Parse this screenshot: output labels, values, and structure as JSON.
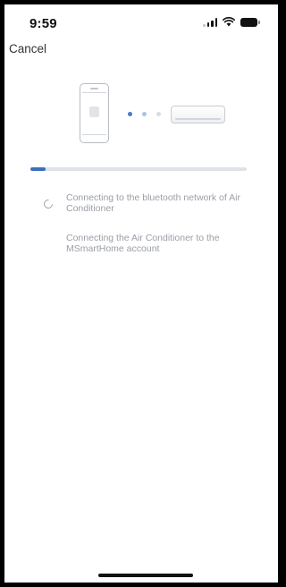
{
  "status_bar": {
    "time": "9:59",
    "icons": [
      "signal-icon",
      "wifi-icon",
      "battery-icon"
    ]
  },
  "header": {
    "cancel_label": "Cancel"
  },
  "illustration": {
    "icons": [
      "phone-icon",
      "progress-dots",
      "air-conditioner-icon"
    ],
    "dot_colors": [
      "#4a7bc8",
      "#aac2e3",
      "#d7dce3"
    ]
  },
  "progress": {
    "fraction": 0.07,
    "color": "#3c6fc1",
    "track_color": "#dfe2e7"
  },
  "steps": [
    {
      "text": "Connecting to the bluetooth network of Air Conditioner",
      "status": "in-progress",
      "icon": "spinner-icon"
    },
    {
      "text": "Connecting the Air Conditioner to the MSmartHome account",
      "status": "pending"
    }
  ]
}
